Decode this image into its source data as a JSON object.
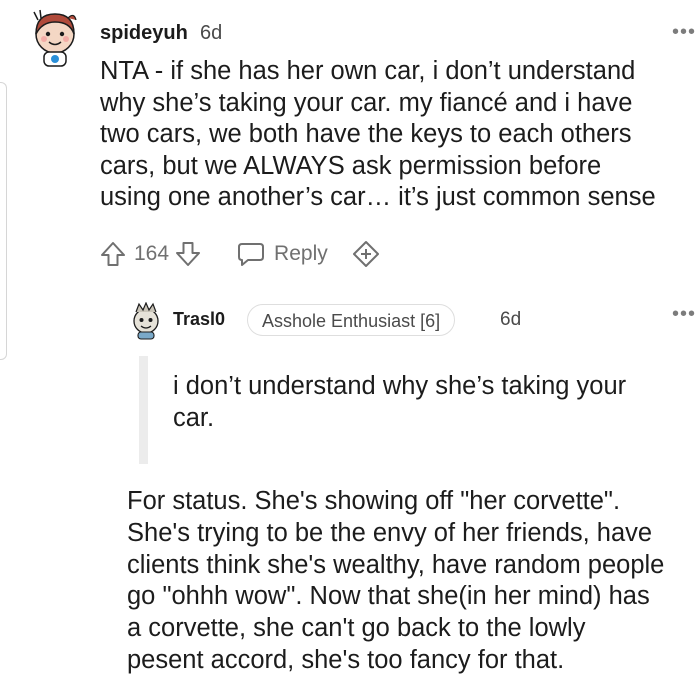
{
  "comment": {
    "username": "spideyuh",
    "time": "6d",
    "more": "•••",
    "body": "NTA - if she has her own car, i don’t understand\nwhy she’s taking your car. my fiancé and i have\ntwo cars, we both have the keys to each others\ncars, but we ALWAYS ask permission before\nusing one another’s car… it’s just common sense",
    "votes": "164",
    "reply_label": "Reply",
    "icons": {
      "avatar": "snoo-avatar-icon",
      "upvote": "upvote-arrow-icon",
      "downvote": "downvote-arrow-icon",
      "reply": "speech-bubble-icon",
      "award": "award-plus-icon"
    }
  },
  "reply": {
    "username": "Trasl0",
    "flair": "Asshole Enthusiast [6]",
    "time": "6d",
    "more": "•••",
    "quote": "i don’t understand why she’s taking your\ncar.",
    "body": "For status. She's showing off \"her corvette\".\nShe's trying to be the envy of her friends, have\nclients think she's wealthy, have random people\ngo \"ohhh wow\". Now that she(in her mind) has\na corvette, she can't go back to the lowly\npesent accord, she's too fancy for that."
  },
  "colors": {
    "text": "#1c1c1c",
    "meta": "#4a4a4a",
    "icon": "#707070",
    "quote_bar": "#ececec",
    "avatar_skin": "#f4d7c4",
    "avatar_hair": "#b04a3a"
  }
}
